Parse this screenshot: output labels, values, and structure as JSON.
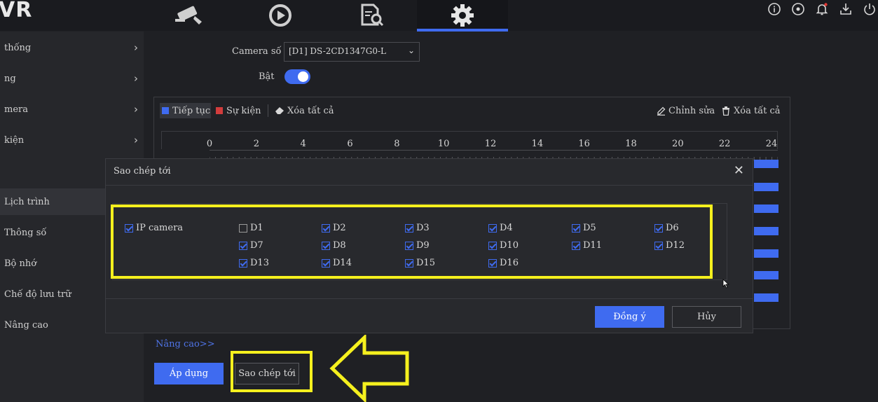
{
  "topbar": {
    "logo": "VR",
    "icons": [
      "camera-icon",
      "playback-icon",
      "search-file-icon",
      "gear-icon"
    ],
    "right_icons": [
      "info-icon",
      "record-icon",
      "bell-icon",
      "download-icon",
      "power-icon"
    ]
  },
  "sidebar": {
    "items": [
      {
        "label": "thống",
        "chevron": "›"
      },
      {
        "label": "ng",
        "chevron": "›"
      },
      {
        "label": "mera",
        "chevron": "›"
      },
      {
        "label": "kiện",
        "chevron": "›"
      },
      {
        "label": "Lịch trình"
      },
      {
        "label": "Thông số"
      },
      {
        "label": "Bộ nhớ"
      },
      {
        "label": "Chế độ lưu trữ"
      },
      {
        "label": "Nâng cao"
      }
    ]
  },
  "main": {
    "camera_label": "Camera số",
    "camera_value": "[D1] DS-2CD1347G0-L",
    "enable_label": "Bật",
    "legend": {
      "continuous": "Tiếp tục",
      "event": "Sự kiện",
      "clear_all": "Xóa tất cả",
      "edit": "Chỉnh sửa",
      "delete_all": "Xóa tất cả"
    },
    "hours": [
      "0",
      "2",
      "4",
      "6",
      "8",
      "10",
      "12",
      "14",
      "16",
      "18",
      "20",
      "22",
      "24"
    ],
    "advanced_link": "Nâng cao>>",
    "apply_button": "Áp dụng",
    "copy_button": "Sao chép tới"
  },
  "modal": {
    "title": "Sao chép tới",
    "close": "✕",
    "group_label": "IP camera",
    "channels": [
      {
        "label": "D1",
        "checked": false
      },
      {
        "label": "D2",
        "checked": true
      },
      {
        "label": "D3",
        "checked": true
      },
      {
        "label": "D4",
        "checked": true
      },
      {
        "label": "D5",
        "checked": true
      },
      {
        "label": "D6",
        "checked": true
      },
      {
        "label": "D7",
        "checked": true
      },
      {
        "label": "D8",
        "checked": true
      },
      {
        "label": "D9",
        "checked": true
      },
      {
        "label": "D10",
        "checked": true
      },
      {
        "label": "D11",
        "checked": true
      },
      {
        "label": "D12",
        "checked": true
      },
      {
        "label": "D13",
        "checked": true
      },
      {
        "label": "D14",
        "checked": true
      },
      {
        "label": "D15",
        "checked": true
      },
      {
        "label": "D16",
        "checked": true
      }
    ],
    "ok_button": "Đồng ý",
    "cancel_button": "Hủy"
  },
  "colors": {
    "accent": "#3f6bf0",
    "event": "#d23c3c",
    "highlight": "#f5f01e"
  }
}
